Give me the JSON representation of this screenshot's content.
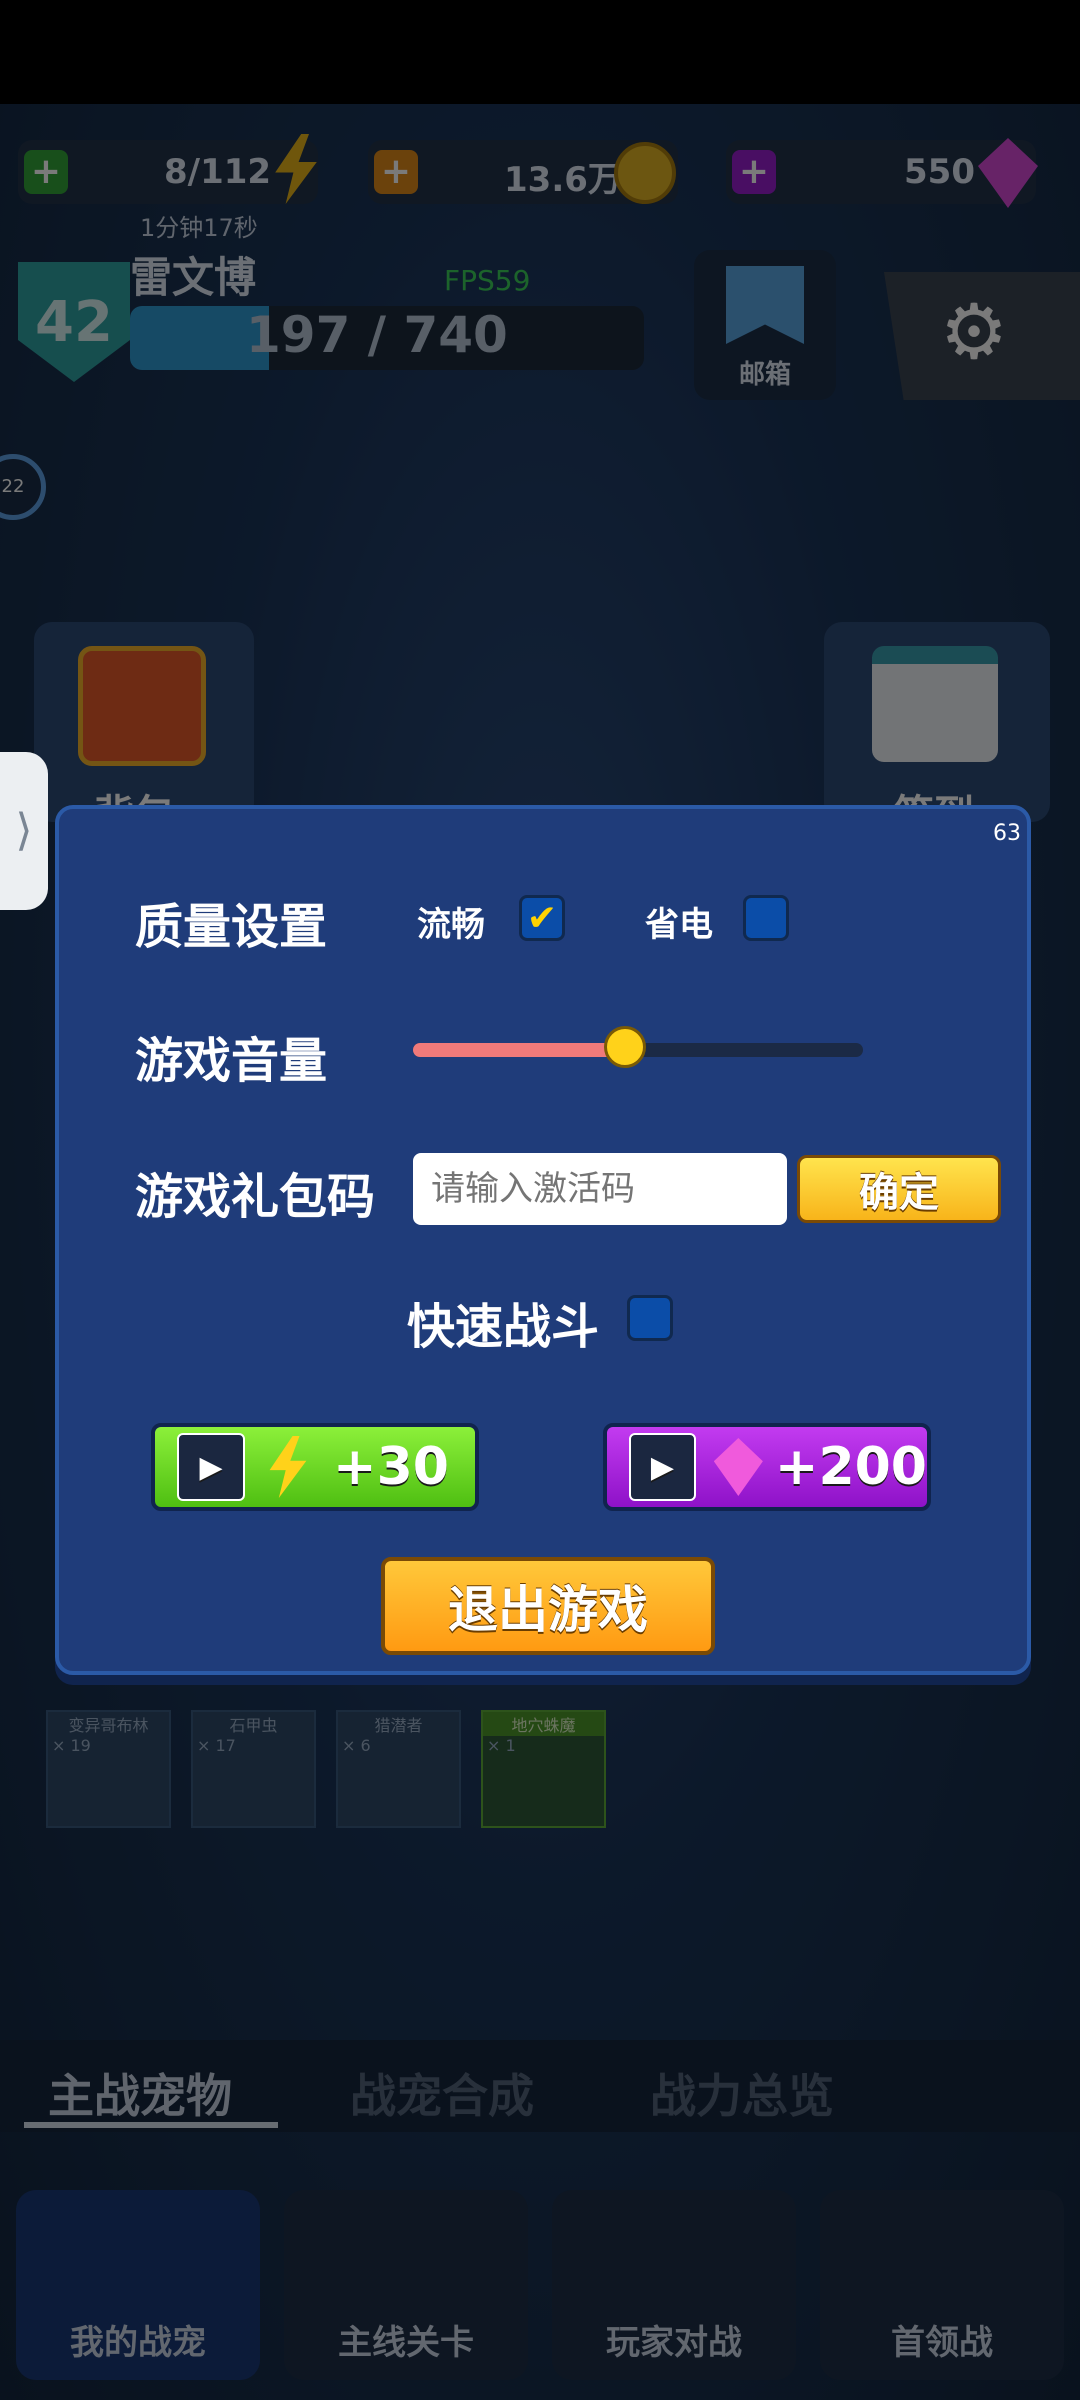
{
  "resources": {
    "energy": "8/112",
    "energy_timer": "1分钟17秒",
    "coins": "13.6万",
    "gems": "550"
  },
  "player": {
    "level": "42",
    "name": "雷文博",
    "xp": "197 / 740",
    "xp_fraction": 0.27,
    "fps": "FPS59"
  },
  "top_buttons": {
    "mail": "邮箱"
  },
  "side_badge": "22",
  "background_tiles": {
    "bag": "背包",
    "sign": "签到"
  },
  "dialog": {
    "corner_number": "63",
    "quality_label": "质量设置",
    "quality_options": [
      {
        "label": "流畅",
        "checked": true
      },
      {
        "label": "省电",
        "checked": false
      }
    ],
    "volume_label": "游戏音量",
    "volume_level": 0.47,
    "gift_label": "游戏礼包码",
    "gift_placeholder": "请输入激活码",
    "confirm_label": "确定",
    "fast_battle_label": "快速战斗",
    "fast_battle_checked": false,
    "reward_energy": "+30",
    "reward_gems": "+200",
    "exit_label": "退出游戏"
  },
  "pet_cards": [
    {
      "name": "变异哥布林",
      "count": "× 19"
    },
    {
      "name": "石甲虫",
      "count": "× 17"
    },
    {
      "name": "猎潜者",
      "count": "× 6"
    },
    {
      "name": "地穴蛛魔",
      "count": "× 1"
    }
  ],
  "tabs": [
    "主战宠物",
    "战宠合成",
    "战力总览"
  ],
  "bottom_nav": [
    "我的战宠",
    "主线关卡",
    "玩家对战",
    "首领战"
  ],
  "colors": {
    "dialog_bg": "#1f3c7a",
    "slider_fill": "#f07a7a",
    "knob": "#ffd21a",
    "energy_button": "#6fdc1f",
    "gem_button": "#a21be0",
    "exit_button": "#ffa21a"
  }
}
